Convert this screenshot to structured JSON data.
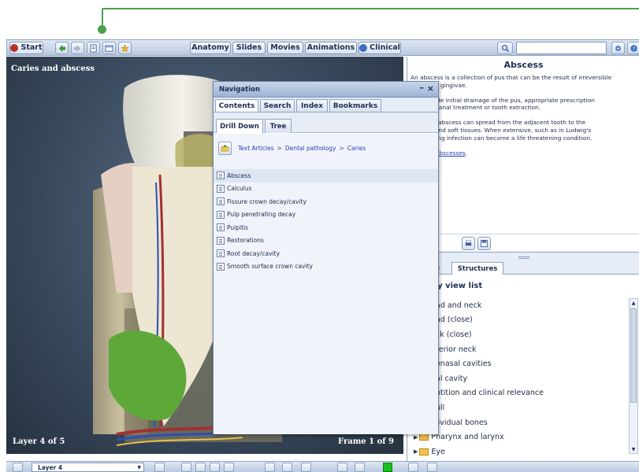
{
  "toolbar": {
    "start_label": "Start",
    "tabs": [
      {
        "label": "Anatomy"
      },
      {
        "label": "Slides"
      },
      {
        "label": "Movies"
      },
      {
        "label": "Animations"
      },
      {
        "label": "Clinical"
      }
    ],
    "search_value": "",
    "icons": [
      "back-arrow-icon",
      "forward-arrow-icon",
      "notes-icon",
      "layout-icon",
      "favorites-star-icon",
      "search-icon",
      "settings-icon",
      "help-icon"
    ]
  },
  "viewer": {
    "title": "Caries and abscess",
    "layer_count": "Layer 4 of 5",
    "frame_count": "Frame 1 of 9"
  },
  "navigation": {
    "title": "Navigation",
    "minimize": "–",
    "close": "×",
    "tabs": [
      {
        "label": "Contents"
      },
      {
        "label": "Search"
      },
      {
        "label": "Index"
      },
      {
        "label": "Bookmarks"
      }
    ],
    "active_tab": "Contents",
    "subtabs": [
      {
        "label": "Drill Down"
      },
      {
        "label": "Tree"
      }
    ],
    "breadcrumb": [
      "Text Articles",
      "Dental pathology",
      "Caries"
    ],
    "breadcrumb_sep": ">",
    "items": [
      {
        "label": "Abscess",
        "selected": true
      },
      {
        "label": "Calculus"
      },
      {
        "label": "Fissure crown decay/cavity"
      },
      {
        "label": "Pulp penetrating decay"
      },
      {
        "label": "Pulpitis"
      },
      {
        "label": "Restorations"
      },
      {
        "label": "Root decay/cavity"
      },
      {
        "label": "Smooth surface crown cavity"
      }
    ]
  },
  "article": {
    "title": "Abscess",
    "para1": "An abscess is a collection of pus that can be the result of irreversible",
    "para1b": "r infected gingivae.",
    "para2": "can include initial drainage of the pus, appropriate prescription",
    "para2b": "ics, root canal treatment or tooth extraction.",
    "para3": "eated an abscess can spread from the adjacent tooth to the",
    "para3b": "ng hard and soft tissues. When extensive, such as in Ludwig's",
    "para3c": "e spreading infection can become a life threatening condition.",
    "link": "alveolar abscesses",
    "link_suffix": "."
  },
  "structures": {
    "tab_partial": "s",
    "tab_label": "Structures",
    "heading": "tomy view list",
    "items": [
      {
        "label": "ad and neck"
      },
      {
        "label": "ad (close)"
      },
      {
        "label": "ck (close)"
      },
      {
        "label": "terior neck"
      },
      {
        "label": "onasal cavities"
      },
      {
        "label": "al cavity"
      },
      {
        "label": "ntition and clinical relevance"
      },
      {
        "label": "ull"
      },
      {
        "label": "lividual bones"
      },
      {
        "label": "Pharynx and larynx"
      },
      {
        "label": "Eye"
      }
    ]
  },
  "bottom": {
    "layer_select": "Layer 4"
  },
  "colors": {
    "callout_green": "#4aa04a",
    "toolbar_blue": "#b9c9de",
    "link_blue": "#2a3fb0",
    "status_green": "#19c11f"
  }
}
